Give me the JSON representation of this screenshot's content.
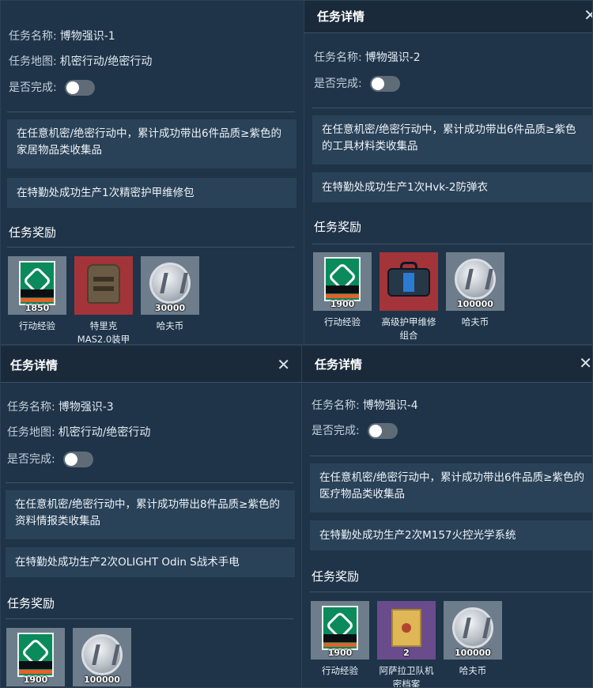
{
  "panels": [
    {
      "header_title": "",
      "name_label": "任务名称:",
      "name_value": "博物强识-1",
      "map_label": "任务地图:",
      "map_value": "机密行动/绝密行动",
      "complete_label": "是否完成:",
      "complete": false,
      "tasks": [
        "在任意机密/绝密行动中，累计成功带出6件品质≥紫色的家居物品类收集品",
        "在特勤处成功生产1次精密护甲维修包"
      ],
      "rewards_title": "任务奖励",
      "rewards": [
        {
          "icon": "xp-card-icon",
          "bg": "#6e7d8b",
          "qty": "1850",
          "name": "行动经验"
        },
        {
          "icon": "armor-vest-icon",
          "bg": "#a2343a",
          "qty": "",
          "name": "特里克MAS2.0装甲"
        },
        {
          "icon": "coin-icon",
          "bg": "#6e7d8b",
          "qty": "30000",
          "name": "哈夫币"
        }
      ]
    },
    {
      "header_title": "任务详情",
      "name_label": "任务名称:",
      "name_value": "博物强识-2",
      "complete_label": "是否完成:",
      "complete": false,
      "tasks": [
        "在任意机密/绝密行动中，累计成功带出6件品质≥紫色的工具材料类收集品",
        "在特勤处成功生产1次Hvk-2防弹衣"
      ],
      "rewards_title": "任务奖励",
      "rewards": [
        {
          "icon": "xp-card-icon",
          "bg": "#6e7d8b",
          "qty": "1900",
          "name": "行动经验"
        },
        {
          "icon": "repair-kit-bag-icon",
          "bg": "#a2343a",
          "qty": "",
          "name": "高级护甲维修组合"
        },
        {
          "icon": "coin-icon",
          "bg": "#6e7d8b",
          "qty": "100000",
          "name": "哈夫币"
        }
      ]
    },
    {
      "header_title": "任务详情",
      "name_label": "任务名称:",
      "name_value": "博物强识-3",
      "map_label": "任务地图:",
      "map_value": "机密行动/绝密行动",
      "complete_label": "是否完成:",
      "complete": false,
      "tasks": [
        "在任意机密/绝密行动中，累计成功带出8件品质≥紫色的资料情报类收集品",
        "在特勤处成功生产2次OLIGHT Odin S战术手电"
      ],
      "rewards_title": "任务奖励",
      "rewards": [
        {
          "icon": "xp-card-icon",
          "bg": "#6e7d8b",
          "qty": "1900",
          "name": ""
        },
        {
          "icon": "coin-icon",
          "bg": "#6e7d8b",
          "qty": "100000",
          "name": ""
        }
      ]
    },
    {
      "header_title": "任务详情",
      "name_label": "任务名称:",
      "name_value": "博物强识-4",
      "complete_label": "是否完成:",
      "complete": false,
      "tasks": [
        "在任意机密/绝密行动中，累计成功带出6件品质≥紫色的医疗物品类收集品",
        "在特勤处成功生产2次M157火控光学系统"
      ],
      "rewards_title": "任务奖励",
      "rewards": [
        {
          "icon": "xp-card-icon",
          "bg": "#6e7d8b",
          "qty": "1900",
          "name": "行动经验"
        },
        {
          "icon": "secret-file-icon",
          "bg": "#6a4b8c",
          "qty": "2",
          "name": "阿萨拉卫队机密档案"
        },
        {
          "icon": "coin-icon",
          "bg": "#6e7d8b",
          "qty": "100000",
          "name": "哈夫币"
        }
      ]
    }
  ],
  "close_glyph": "✕"
}
